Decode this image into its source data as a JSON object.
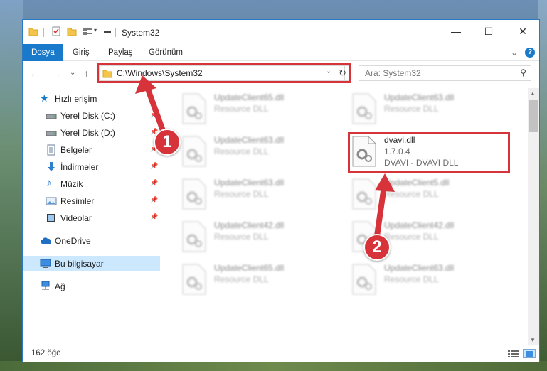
{
  "window": {
    "title": "System32",
    "minimize": "—",
    "maximize": "☐",
    "close": "✕"
  },
  "ribbon": {
    "tabs": [
      "Dosya",
      "Giriş",
      "Paylaş",
      "Görünüm"
    ],
    "collapse": "⌄",
    "help": "?"
  },
  "nav": {
    "back": "←",
    "forward": "→",
    "recent": "⌄",
    "up": "↑",
    "address": "C:\\Windows\\System32",
    "address_dropdown": "⌄",
    "refresh": "↻",
    "search_placeholder": "Ara: System32",
    "search_icon": "⚲"
  },
  "sidebar": {
    "items": [
      {
        "label": "Hızlı erişim",
        "icon": "star-icon"
      },
      {
        "label": "Yerel Disk (C:)",
        "icon": "drive-icon",
        "pinned": true
      },
      {
        "label": "Yerel Disk (D:)",
        "icon": "drive-icon",
        "pinned": true
      },
      {
        "label": "Belgeler",
        "icon": "documents-icon",
        "pinned": true
      },
      {
        "label": "İndirmeler",
        "icon": "download-icon",
        "pinned": true
      },
      {
        "label": "Müzik",
        "icon": "music-icon",
        "pinned": true
      },
      {
        "label": "Resimler",
        "icon": "pictures-icon",
        "pinned": true
      },
      {
        "label": "Videolar",
        "icon": "videos-icon",
        "pinned": true
      },
      {
        "label": "OneDrive",
        "icon": "cloud-icon"
      },
      {
        "label": "Bu bilgisayar",
        "icon": "computer-icon",
        "selected": true
      },
      {
        "label": "Ağ",
        "icon": "network-icon"
      }
    ],
    "pin_glyph": "📌"
  },
  "files": [
    {
      "name": "UpdateClient65.dll",
      "desc": "Resource DLL",
      "blurred": true
    },
    {
      "name": "UpdateClient63.dll",
      "desc": "Resource DLL",
      "blurred": true
    },
    {
      "name": "UpdateClient63.dll",
      "desc": "Resource DLL",
      "blurred": true
    },
    {
      "name": "dvavi.dll",
      "version": "1.7.0.4",
      "desc": "DVAVI - DVAVI DLL",
      "blurred": false
    },
    {
      "name": "UpdateClient63.dll",
      "desc": "Resource DLL",
      "blurred": true
    },
    {
      "name": "UpdateClient5.dll",
      "desc": "Resource DLL",
      "blurred": true
    },
    {
      "name": "UpdateClient42.dll",
      "desc": "Resource DLL",
      "blurred": true
    },
    {
      "name": "UpdateClient42.dll",
      "desc": "Resource DLL",
      "blurred": true
    },
    {
      "name": "UpdateClient65.dll",
      "desc": "Resource DLL",
      "blurred": true
    },
    {
      "name": "UpdateClient63.dll",
      "desc": "Resource DLL",
      "blurred": true
    }
  ],
  "status": {
    "count": "162 öğe"
  },
  "callouts": [
    "1",
    "2"
  ],
  "colors": {
    "accent": "#1979ca",
    "highlight": "#d6333a",
    "selected": "#cce8ff"
  }
}
